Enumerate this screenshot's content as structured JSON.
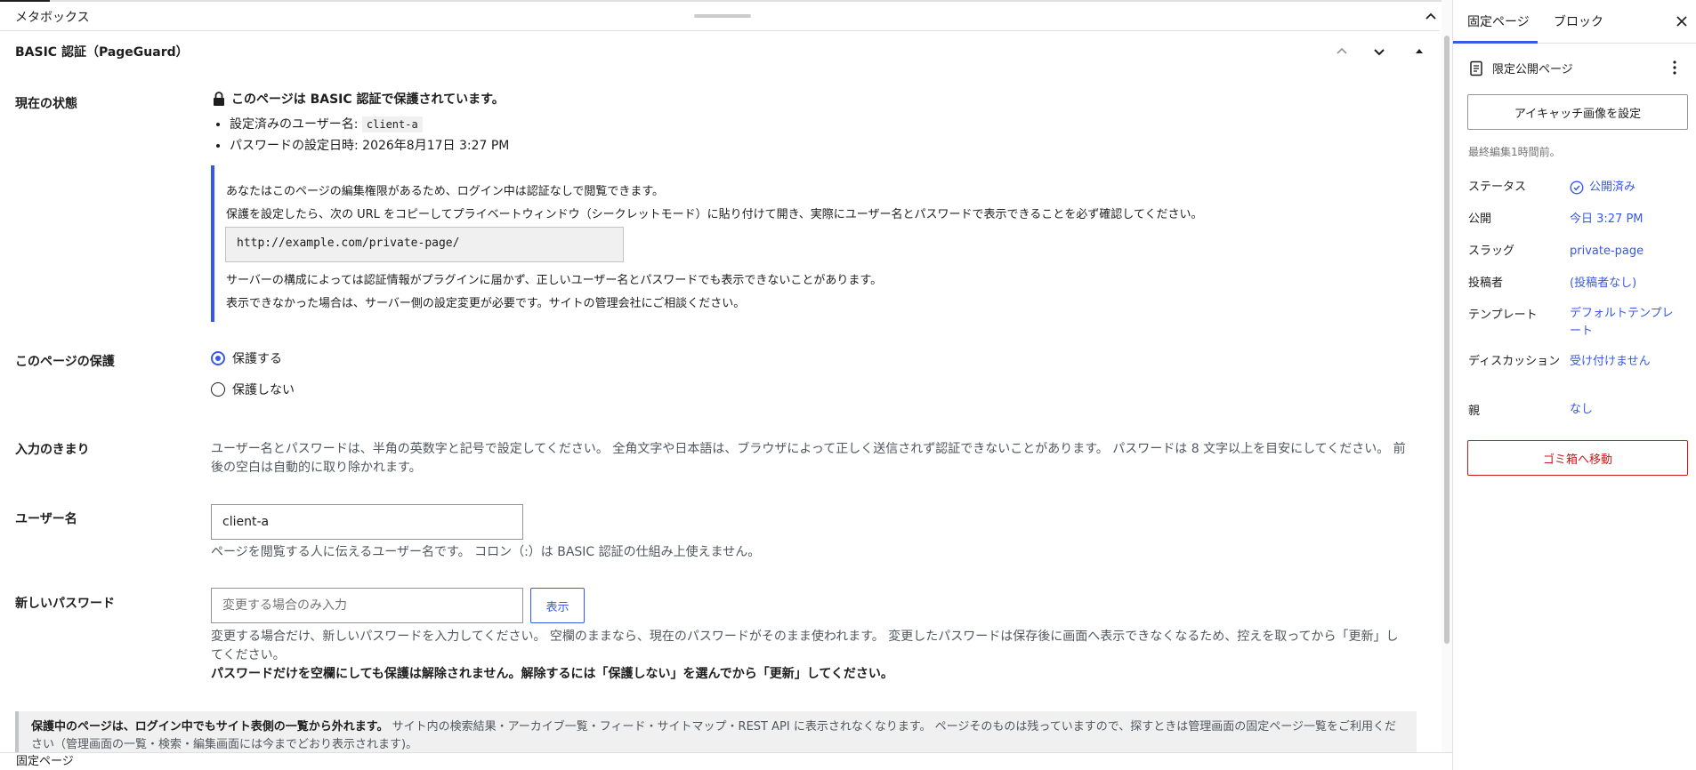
{
  "metabox": {
    "title": "メタボックス"
  },
  "postbox": {
    "title": "BASIC 認証（PageGuard）"
  },
  "status": {
    "label": "現在の状態",
    "heading": "このページは BASIC 認証で保護されています。",
    "user_prefix": "設定済みのユーザー名:",
    "user_value": "client-a",
    "date_line": "パスワードの設定日時: 2026年8月17日 3:27 PM"
  },
  "notice": {
    "line1": "あなたはこのページの編集権限があるため、ログイン中は認証なしで閲覧できます。",
    "line2": "保護を設定したら、次の URL をコピーしてプライベートウィンドウ（シークレットモード）に貼り付けて開き、実際にユーザー名とパスワードで表示できることを必ず確認してください。",
    "url": "http://example.com/private-page/",
    "line3": "サーバーの構成によっては認証情報がプラグインに届かず、正しいユーザー名とパスワードでも表示できないことがあります。",
    "line4": "表示できなかった場合は、サーバー側の設定変更が必要です。サイトの管理会社にご相談ください。"
  },
  "protection": {
    "label": "このページの保護",
    "options": [
      "保護する",
      "保護しない"
    ],
    "selected": "保護する"
  },
  "rules": {
    "label": "入力のきまり",
    "text": "ユーザー名とパスワードは、半角の英数字と記号で設定してください。 全角文字や日本語は、ブラウザによって正しく送信されず認証できないことがあります。 パスワードは 8 文字以上を目安にしてください。 前後の空白は自動的に取り除かれます。"
  },
  "username": {
    "label": "ユーザー名",
    "value": "client-a",
    "help": "ページを閲覧する人に伝えるユーザー名です。 コロン（:）は BASIC 認証の仕組み上使えません。"
  },
  "password": {
    "label": "新しいパスワード",
    "placeholder": "変更する場合のみ入力",
    "show_label": "表示",
    "help": "変更する場合だけ、新しいパスワードを入力してください。 空欄のままなら、現在のパスワードがそのまま使われます。 変更したパスワードは保存後に画面へ表示できなくなるため、控えを取ってから「更新」してください。",
    "warning": "パスワードだけを空欄にしても保護は解除されません。解除するには「保護しない」を選んでから「更新」してください。"
  },
  "bottom_notice": {
    "bold": "保護中のページは、ログイン中でもサイト表側の一覧から外れます。",
    "text": " サイト内の検索結果・アーカイブ一覧・フィード・サイトマップ・REST API に表示されなくなります。 ページそのものは残っていますので、探すときは管理画面の固定ページ一覧をご利用ください（管理画面の一覧・検索・編集画面には今までどおり表示されます)。"
  },
  "footer": {
    "breadcrumb": "固定ページ"
  },
  "sidebar": {
    "tabs": [
      "固定ページ",
      "ブロック"
    ],
    "page_type": "限定公開ページ",
    "featured_image": "アイキャッチ画像を設定",
    "last_edited": "最終編集1時間前。",
    "rows": [
      {
        "label": "ステータス",
        "value": "公開済み"
      },
      {
        "label": "公開",
        "value": "今日 3:27 PM"
      },
      {
        "label": "スラッグ",
        "value": "private-page"
      },
      {
        "label": "投稿者",
        "value": "(投稿者なし)"
      },
      {
        "label": "テンプレート",
        "value": "デフォルトテンプレート"
      },
      {
        "label": "ディスカッション",
        "value": "受け付けません"
      },
      {
        "label": "親",
        "value": "なし"
      }
    ],
    "trash": "ゴミ箱へ移動"
  },
  "colors": {
    "accent": "#3858e9",
    "danger": "#cc1818"
  }
}
